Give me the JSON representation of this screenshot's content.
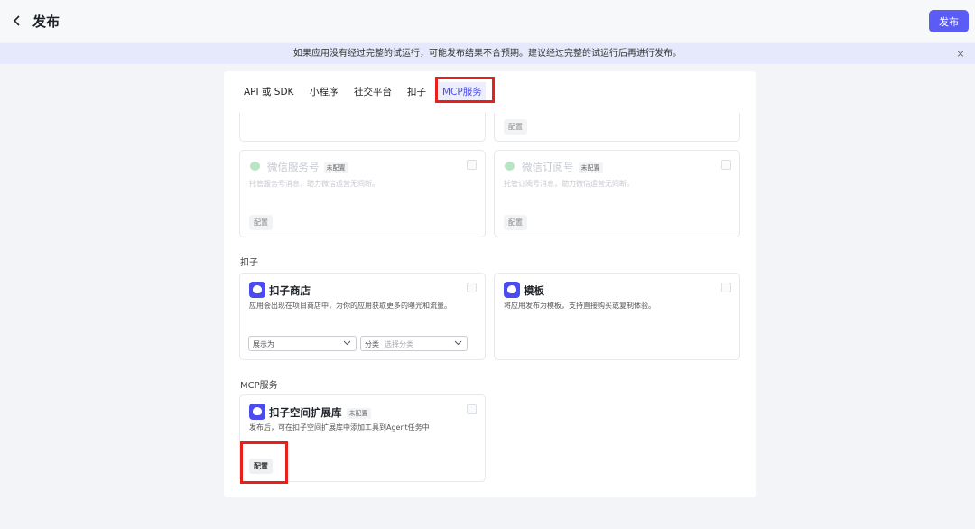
{
  "header": {
    "title": "发布",
    "publish_label": "发布"
  },
  "banner": {
    "text": "如果应用没有经过完整的试运行，可能发布结果不合预期。建议经过完整的试运行后再进行发布。",
    "close": "×"
  },
  "tabs": [
    {
      "label": "API 或 SDK"
    },
    {
      "label": "小程序"
    },
    {
      "label": "社交平台"
    },
    {
      "label": "扣子"
    },
    {
      "label": "MCP服务",
      "active": true
    }
  ],
  "social": {
    "top_left_card": {},
    "top_right_card": {
      "config": "配置"
    },
    "wechat_service": {
      "title": "微信服务号",
      "badge": "未配置",
      "desc": "托管服务号消息，助力微信运营无间断。",
      "config": "配置"
    },
    "wechat_subscription": {
      "title": "微信订阅号",
      "badge": "未配置",
      "desc": "托管订阅号消息，助力微信运营无间断。",
      "config": "配置"
    }
  },
  "coze_section": {
    "label": "扣子",
    "store": {
      "title": "扣子商店",
      "desc": "应用会出现在项目商店中，为你的应用获取更多的曝光和流量。",
      "display_select": "展示为",
      "category_select": "分类",
      "category_placeholder": "选择分类"
    },
    "template": {
      "title": "模板",
      "desc": "将应用发布为模板，支持直接购买或复制体验。"
    }
  },
  "mcp_section": {
    "label": "MCP服务",
    "extension": {
      "title": "扣子空间扩展库",
      "badge": "未配置",
      "desc": "发布后，可在扣子空间扩展库中添加工具到Agent任务中",
      "config": "配置"
    }
  },
  "colors": {
    "primary": "#5a5cf5",
    "banner_bg": "#e5e9fb",
    "highlight": "#e8201c",
    "wechat_green": "#b8e6c4"
  }
}
